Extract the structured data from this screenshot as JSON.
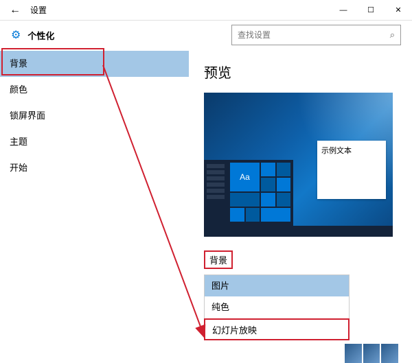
{
  "titlebar": {
    "title": "设置"
  },
  "header": {
    "title": "个性化",
    "search_placeholder": "查找设置"
  },
  "sidebar": {
    "items": [
      {
        "label": "背景"
      },
      {
        "label": "颜色"
      },
      {
        "label": "锁屏界面"
      },
      {
        "label": "主题"
      },
      {
        "label": "开始"
      }
    ]
  },
  "main": {
    "preview_title": "预览",
    "sample_text": "示例文本",
    "aa": "Aa",
    "bg_label": "背景",
    "options": [
      {
        "label": "图片"
      },
      {
        "label": "纯色"
      },
      {
        "label": "幻灯片放映"
      }
    ]
  }
}
